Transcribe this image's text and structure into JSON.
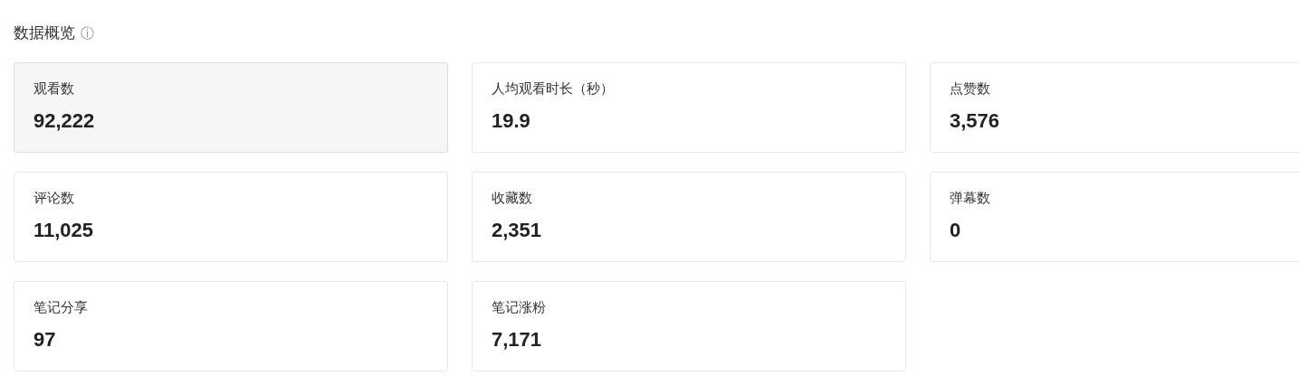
{
  "title": "数据概览",
  "info_icon": "ⓘ",
  "metrics": [
    {
      "label": "观看数",
      "value": "92,222",
      "selected": true
    },
    {
      "label": "人均观看时长（秒）",
      "value": "19.9",
      "selected": false
    },
    {
      "label": "点赞数",
      "value": "3,576",
      "selected": false
    },
    {
      "label": "评论数",
      "value": "11,025",
      "selected": false
    },
    {
      "label": "收藏数",
      "value": "2,351",
      "selected": false
    },
    {
      "label": "弹幕数",
      "value": "0",
      "selected": false
    },
    {
      "label": "笔记分享",
      "value": "97",
      "selected": false
    },
    {
      "label": "笔记涨粉",
      "value": "7,171",
      "selected": false
    }
  ]
}
